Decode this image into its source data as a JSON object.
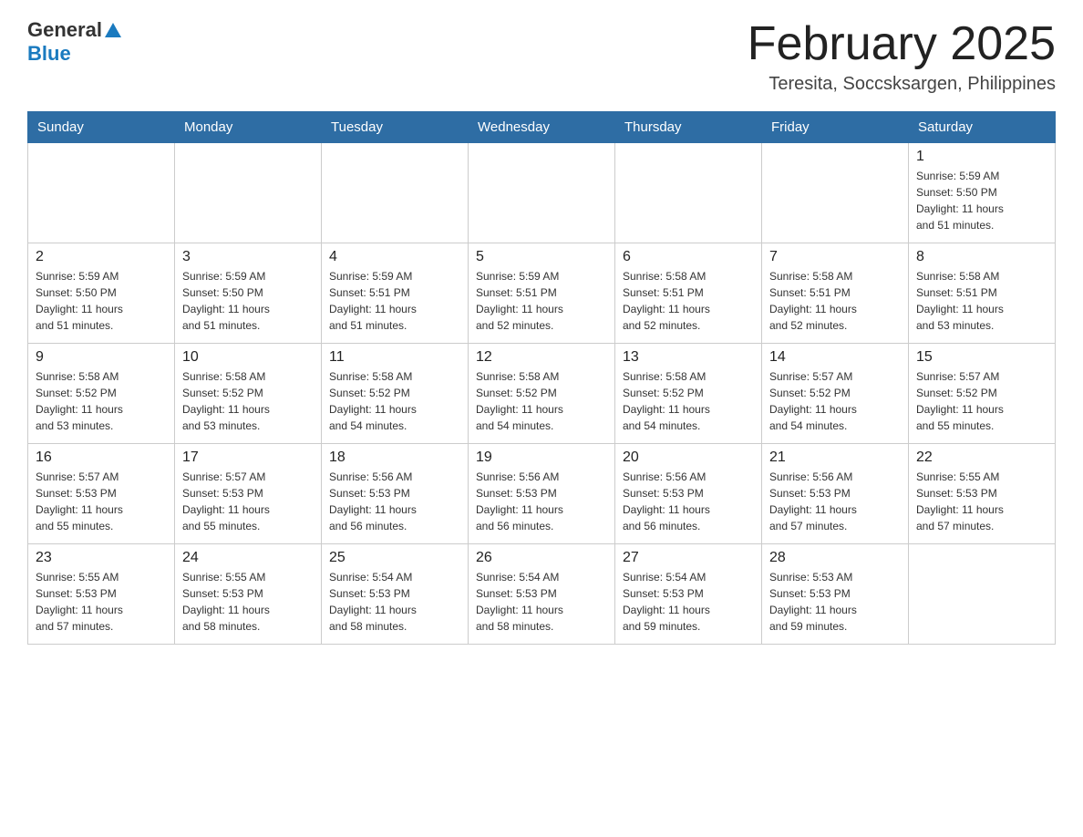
{
  "header": {
    "logo_general": "General",
    "logo_arrow": "▲",
    "logo_blue": "Blue",
    "title": "February 2025",
    "subtitle": "Teresita, Soccsksargen, Philippines"
  },
  "days_of_week": [
    "Sunday",
    "Monday",
    "Tuesday",
    "Wednesday",
    "Thursday",
    "Friday",
    "Saturday"
  ],
  "weeks": [
    {
      "days": [
        {
          "number": "",
          "info": ""
        },
        {
          "number": "",
          "info": ""
        },
        {
          "number": "",
          "info": ""
        },
        {
          "number": "",
          "info": ""
        },
        {
          "number": "",
          "info": ""
        },
        {
          "number": "",
          "info": ""
        },
        {
          "number": "1",
          "info": "Sunrise: 5:59 AM\nSunset: 5:50 PM\nDaylight: 11 hours\nand 51 minutes."
        }
      ]
    },
    {
      "days": [
        {
          "number": "2",
          "info": "Sunrise: 5:59 AM\nSunset: 5:50 PM\nDaylight: 11 hours\nand 51 minutes."
        },
        {
          "number": "3",
          "info": "Sunrise: 5:59 AM\nSunset: 5:50 PM\nDaylight: 11 hours\nand 51 minutes."
        },
        {
          "number": "4",
          "info": "Sunrise: 5:59 AM\nSunset: 5:51 PM\nDaylight: 11 hours\nand 51 minutes."
        },
        {
          "number": "5",
          "info": "Sunrise: 5:59 AM\nSunset: 5:51 PM\nDaylight: 11 hours\nand 52 minutes."
        },
        {
          "number": "6",
          "info": "Sunrise: 5:58 AM\nSunset: 5:51 PM\nDaylight: 11 hours\nand 52 minutes."
        },
        {
          "number": "7",
          "info": "Sunrise: 5:58 AM\nSunset: 5:51 PM\nDaylight: 11 hours\nand 52 minutes."
        },
        {
          "number": "8",
          "info": "Sunrise: 5:58 AM\nSunset: 5:51 PM\nDaylight: 11 hours\nand 53 minutes."
        }
      ]
    },
    {
      "days": [
        {
          "number": "9",
          "info": "Sunrise: 5:58 AM\nSunset: 5:52 PM\nDaylight: 11 hours\nand 53 minutes."
        },
        {
          "number": "10",
          "info": "Sunrise: 5:58 AM\nSunset: 5:52 PM\nDaylight: 11 hours\nand 53 minutes."
        },
        {
          "number": "11",
          "info": "Sunrise: 5:58 AM\nSunset: 5:52 PM\nDaylight: 11 hours\nand 54 minutes."
        },
        {
          "number": "12",
          "info": "Sunrise: 5:58 AM\nSunset: 5:52 PM\nDaylight: 11 hours\nand 54 minutes."
        },
        {
          "number": "13",
          "info": "Sunrise: 5:58 AM\nSunset: 5:52 PM\nDaylight: 11 hours\nand 54 minutes."
        },
        {
          "number": "14",
          "info": "Sunrise: 5:57 AM\nSunset: 5:52 PM\nDaylight: 11 hours\nand 54 minutes."
        },
        {
          "number": "15",
          "info": "Sunrise: 5:57 AM\nSunset: 5:52 PM\nDaylight: 11 hours\nand 55 minutes."
        }
      ]
    },
    {
      "days": [
        {
          "number": "16",
          "info": "Sunrise: 5:57 AM\nSunset: 5:53 PM\nDaylight: 11 hours\nand 55 minutes."
        },
        {
          "number": "17",
          "info": "Sunrise: 5:57 AM\nSunset: 5:53 PM\nDaylight: 11 hours\nand 55 minutes."
        },
        {
          "number": "18",
          "info": "Sunrise: 5:56 AM\nSunset: 5:53 PM\nDaylight: 11 hours\nand 56 minutes."
        },
        {
          "number": "19",
          "info": "Sunrise: 5:56 AM\nSunset: 5:53 PM\nDaylight: 11 hours\nand 56 minutes."
        },
        {
          "number": "20",
          "info": "Sunrise: 5:56 AM\nSunset: 5:53 PM\nDaylight: 11 hours\nand 56 minutes."
        },
        {
          "number": "21",
          "info": "Sunrise: 5:56 AM\nSunset: 5:53 PM\nDaylight: 11 hours\nand 57 minutes."
        },
        {
          "number": "22",
          "info": "Sunrise: 5:55 AM\nSunset: 5:53 PM\nDaylight: 11 hours\nand 57 minutes."
        }
      ]
    },
    {
      "days": [
        {
          "number": "23",
          "info": "Sunrise: 5:55 AM\nSunset: 5:53 PM\nDaylight: 11 hours\nand 57 minutes."
        },
        {
          "number": "24",
          "info": "Sunrise: 5:55 AM\nSunset: 5:53 PM\nDaylight: 11 hours\nand 58 minutes."
        },
        {
          "number": "25",
          "info": "Sunrise: 5:54 AM\nSunset: 5:53 PM\nDaylight: 11 hours\nand 58 minutes."
        },
        {
          "number": "26",
          "info": "Sunrise: 5:54 AM\nSunset: 5:53 PM\nDaylight: 11 hours\nand 58 minutes."
        },
        {
          "number": "27",
          "info": "Sunrise: 5:54 AM\nSunset: 5:53 PM\nDaylight: 11 hours\nand 59 minutes."
        },
        {
          "number": "28",
          "info": "Sunrise: 5:53 AM\nSunset: 5:53 PM\nDaylight: 11 hours\nand 59 minutes."
        },
        {
          "number": "",
          "info": ""
        }
      ]
    }
  ]
}
